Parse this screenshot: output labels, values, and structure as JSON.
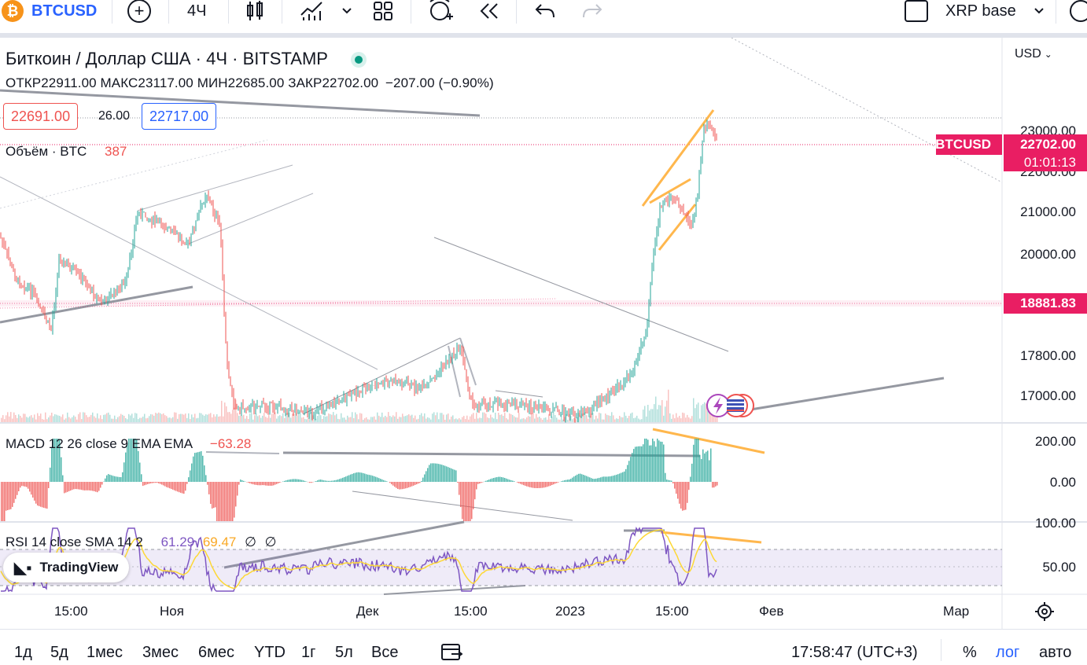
{
  "toolbar": {
    "symbol": "BTCUSD",
    "interval": "4Ч",
    "compare_label": "XRP base"
  },
  "legend": {
    "title": "Биткоин / Доллар США · 4Ч · BITSTAMP",
    "open_label": "ОТКР",
    "open": "22911.00",
    "high_label": "МАКС",
    "high": "23117.00",
    "low_label": "МИН",
    "low": "22685.00",
    "close_label": "ЗАКР",
    "close": "22702.00",
    "change": "−207.00 (−0.90%)",
    "bid": "22691.00",
    "spread": "26.00",
    "ask": "22717.00",
    "volume_label": "Объём · BTC",
    "volume_value": "387",
    "colors": {
      "up": "#26a69a",
      "down": "#ef5350",
      "accent": "#2962ff",
      "tag": "#e91e63"
    }
  },
  "price_axis": {
    "currency": "USD",
    "labels": [
      "23000.00",
      "22000.00",
      "21000.00",
      "20000.00",
      "17800.00",
      "17000.00"
    ],
    "symbol_tag": "BTCUSD",
    "last_price": "22702.00",
    "countdown": "01:01:13",
    "level_tag": "18881.83"
  },
  "macd": {
    "label": "MACD 12 26 close 9 EMA EMA",
    "value": "−63.28",
    "axis": [
      "200.00",
      "0.00"
    ]
  },
  "rsi": {
    "label": "RSI 14 close SMA 14 2",
    "v1": "61.29",
    "v2": "69.47",
    "v3": "∅",
    "v4": "∅",
    "axis": [
      "100.00",
      "50.00"
    ]
  },
  "brand": "TradingView",
  "time_axis": [
    "15:00",
    "Ноя",
    "Дек",
    "15:00",
    "2023",
    "15:00",
    "Фев",
    "Мар"
  ],
  "ranges": [
    "1д",
    "5д",
    "1мес",
    "3мес",
    "6мес",
    "YTD",
    "1г",
    "5л",
    "Все"
  ],
  "clock": "17:58:47 (UTC+3)",
  "percent": "%",
  "log": "лог",
  "auto": "авто"
}
